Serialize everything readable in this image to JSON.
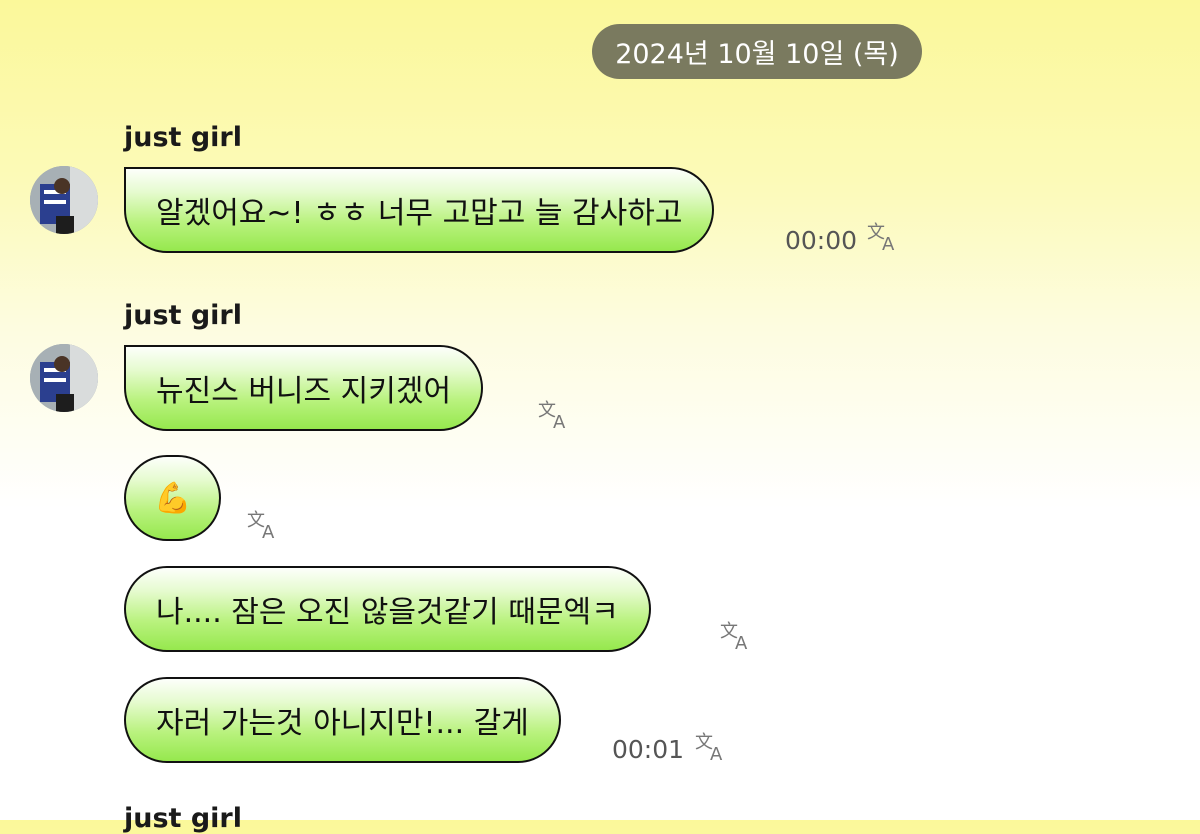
{
  "chat": {
    "date_divider": "2024년 10월 10일 (목)",
    "groups": [
      {
        "sender": "just girl",
        "messages": [
          {
            "text": "알겠어요~! ㅎㅎ 너무 고맙고 늘 감사하고",
            "time": "00:00"
          }
        ]
      },
      {
        "sender": "just girl",
        "messages": [
          {
            "text": "뉴진스 버니즈 지키겠어"
          },
          {
            "text": "💪"
          },
          {
            "text": "나.... 잠은 오진 않을것같기 때문엑ㅋ"
          },
          {
            "text": "자러 가는것 아니지만!... 갈게",
            "time": "00:01"
          }
        ]
      },
      {
        "sender": "just girl",
        "messages": []
      }
    ]
  },
  "icons": {
    "translate": "translate-icon",
    "avatar": "profile-photo"
  },
  "colors": {
    "bubble_green": "#96e84e",
    "date_pill": "#7a7a5f",
    "background_top": "#fbf89a"
  }
}
